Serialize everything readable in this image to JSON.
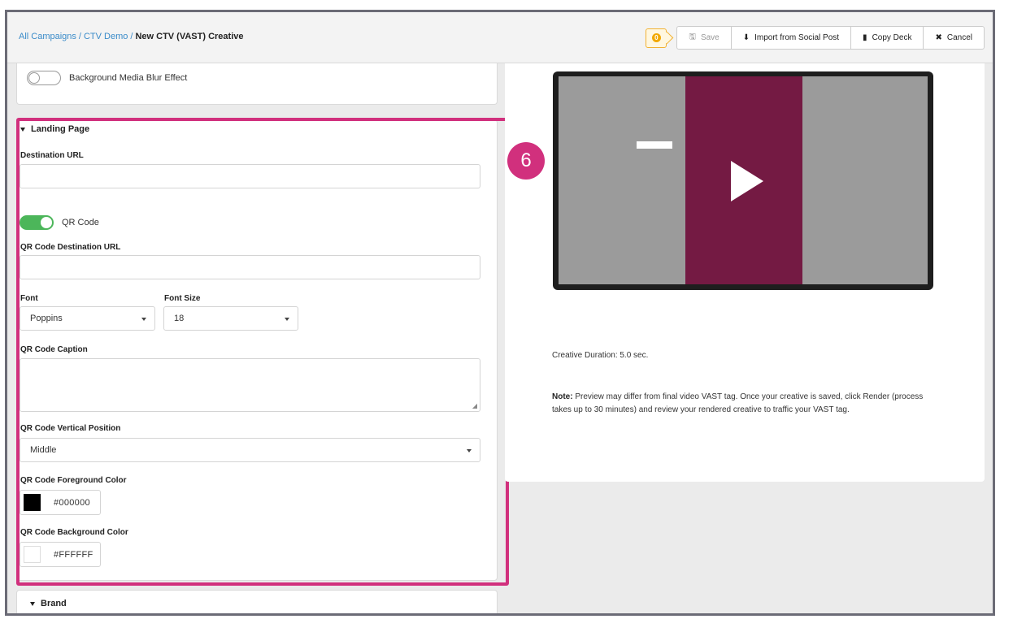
{
  "breadcrumb": {
    "crumb1": "All Campaigns",
    "crumb2": "CTV Demo",
    "current": "New CTV (VAST) Creative"
  },
  "toolbar": {
    "warning_count": "0",
    "save_label": "Save",
    "import_label": "Import from Social Post",
    "copy_label": "Copy Deck",
    "cancel_label": "Cancel"
  },
  "blur_toggle": {
    "label": "Background Media Blur Effect",
    "on": false
  },
  "landing_page": {
    "title": "Landing Page",
    "destination_url_label": "Destination URL",
    "destination_url_value": "",
    "qr_toggle_label": "QR Code",
    "qr_toggle_on": true,
    "qr_dest_label": "QR Code Destination URL",
    "qr_dest_value": "",
    "font_label": "Font",
    "font_value": "Poppins",
    "font_size_label": "Font Size",
    "font_size_value": "18",
    "caption_label": "QR Code Caption",
    "caption_value": "",
    "vertical_label": "QR Code Vertical Position",
    "vertical_value": "Middle",
    "fg_label": "QR Code Foreground Color",
    "fg_value": "#000000",
    "bg_label": "QR Code Background Color",
    "bg_value": "#FFFFFF"
  },
  "brand": {
    "title": "Brand"
  },
  "step_badge": "6",
  "preview": {
    "duration_text": "Creative Duration: 5.0 sec.",
    "note_bold": "Note:",
    "note_text": " Preview may differ from final video VAST tag. Once your creative is saved, click Render (process takes up to 30 minutes) and review your rendered creative to traffic your VAST tag."
  },
  "colors": {
    "highlight": "#d1307d",
    "toggle_on": "#4cb65a",
    "link": "#3a8bc9",
    "video_band": "#741a43"
  }
}
